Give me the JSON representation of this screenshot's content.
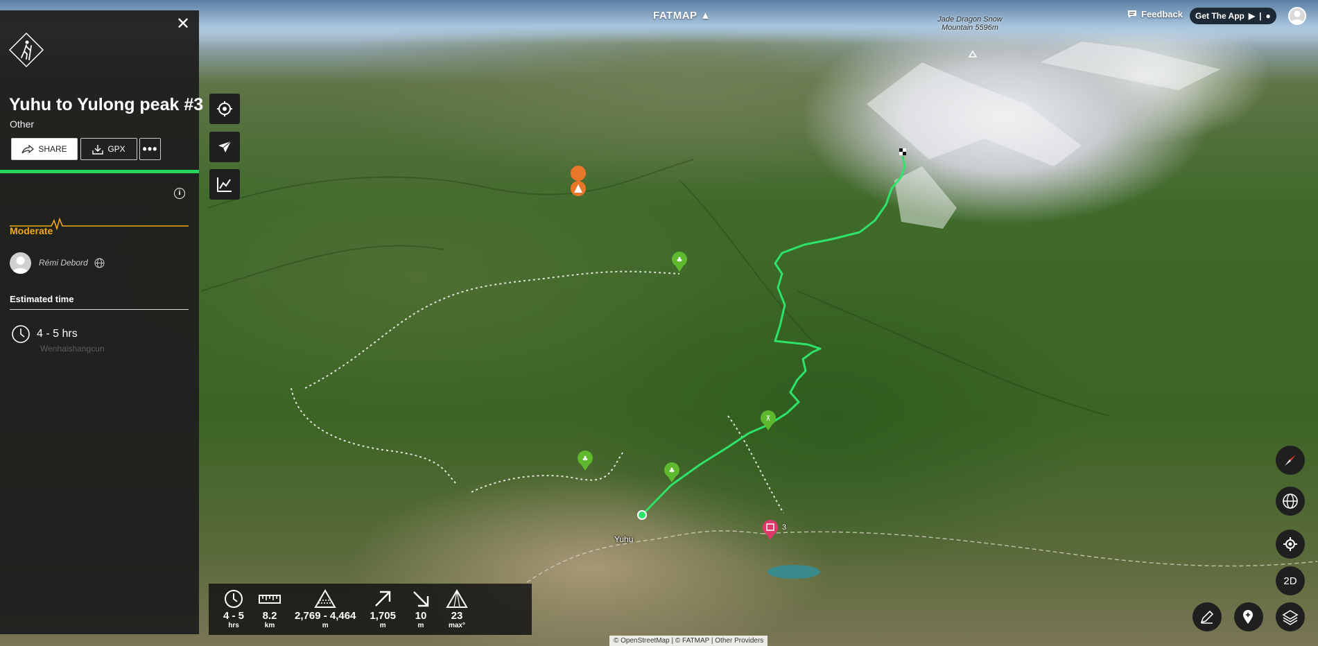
{
  "header": {
    "logo": "FATMAP",
    "feedback_label": "Feedback",
    "get_app_label": "Get The App"
  },
  "map": {
    "peak_label": "Jade Dragon Snow Mountain 5596m",
    "village_label": "Yuhu",
    "poi_count": "3",
    "attribution": "© OpenStreetMap | © FATMAP | Other Providers",
    "route_color": "#2ee36a",
    "marker_colors": {
      "green": "#5fb92f",
      "orange": "#e8772a",
      "red": "#e0386b"
    }
  },
  "panel": {
    "title": "Yuhu to Yulong peak #3",
    "type": "Other",
    "share_label": "SHARE",
    "gpx_label": "GPX",
    "more_label": "•••",
    "progress": 1.0,
    "difficulty": "Moderate",
    "difficulty_color": "#f2a81a",
    "author": "Rémi Debord",
    "estimated_title": "Estimated time",
    "estimated_value": "4 - 5 hrs",
    "place_ghost": "Wenhaishangcun"
  },
  "stats": [
    {
      "icon": "clock-icon",
      "value": "4 - 5",
      "unit": "hrs"
    },
    {
      "icon": "ruler-icon",
      "value": "8.2",
      "unit": "km"
    },
    {
      "icon": "elevation-range-icon",
      "value": "2,769 - 4,464",
      "unit": "m"
    },
    {
      "icon": "ascent-icon",
      "value": "1,705",
      "unit": "m"
    },
    {
      "icon": "descent-icon",
      "value": "10",
      "unit": "m"
    },
    {
      "icon": "slope-icon",
      "value": "23",
      "unit": "max°"
    }
  ],
  "controls": {
    "view_mode": "2D"
  }
}
